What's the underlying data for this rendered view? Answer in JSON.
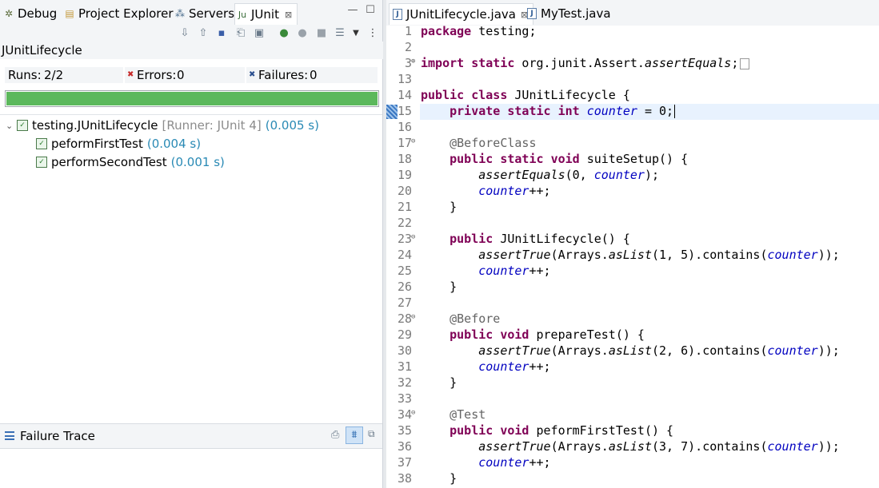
{
  "left_tabs": [
    {
      "label": "Debug",
      "icon": "bug-icon"
    },
    {
      "label": "Project Explorer",
      "icon": "folder-icon"
    },
    {
      "label": "Servers",
      "icon": "servers-icon"
    },
    {
      "label": "JUnit",
      "icon": "junit-icon"
    }
  ],
  "junit": {
    "title": "JUnitLifecycle",
    "runs_label": "Runs:",
    "runs_value": "2/2",
    "errors_label": "Errors:",
    "errors_value": "0",
    "failures_label": "Failures:",
    "failures_value": "0",
    "progress": 1.0,
    "progress_color": "#5cb85c",
    "tree": {
      "suite_label": "testing.JUnitLifecycle",
      "suite_runner": "[Runner: JUnit 4]",
      "suite_time": "(0.005 s)",
      "tests": [
        {
          "name": "peformFirstTest",
          "time": "(0.004 s)"
        },
        {
          "name": "performSecondTest",
          "time": "(0.001 s)"
        }
      ]
    },
    "failure_trace_label": "Failure Trace"
  },
  "editor": {
    "tabs": [
      {
        "label": "JUnitLifecycle.java",
        "active": true
      },
      {
        "label": "MyTest.java",
        "active": false
      }
    ],
    "lines": [
      {
        "n": "1",
        "t": "package testing;"
      },
      {
        "n": "2",
        "t": ""
      },
      {
        "n": "3",
        "t": "import static org.junit.Assert.assertEquals;"
      },
      {
        "n": "13",
        "t": ""
      },
      {
        "n": "14",
        "t": "public class JUnitLifecycle {"
      },
      {
        "n": "15",
        "t": "    private static int counter = 0;"
      },
      {
        "n": "16",
        "t": ""
      },
      {
        "n": "17",
        "t": "    @BeforeClass"
      },
      {
        "n": "18",
        "t": "    public static void suiteSetup() {"
      },
      {
        "n": "19",
        "t": "        assertEquals(0, counter);"
      },
      {
        "n": "20",
        "t": "        counter++;"
      },
      {
        "n": "21",
        "t": "    }"
      },
      {
        "n": "22",
        "t": ""
      },
      {
        "n": "23",
        "t": "    public JUnitLifecycle() {"
      },
      {
        "n": "24",
        "t": "        assertTrue(Arrays.asList(1, 5).contains(counter));"
      },
      {
        "n": "25",
        "t": "        counter++;"
      },
      {
        "n": "26",
        "t": "    }"
      },
      {
        "n": "27",
        "t": ""
      },
      {
        "n": "28",
        "t": "    @Before"
      },
      {
        "n": "29",
        "t": "    public void prepareTest() {"
      },
      {
        "n": "30",
        "t": "        assertTrue(Arrays.asList(2, 6).contains(counter));"
      },
      {
        "n": "31",
        "t": "        counter++;"
      },
      {
        "n": "32",
        "t": "    }"
      },
      {
        "n": "33",
        "t": ""
      },
      {
        "n": "34",
        "t": "    @Test"
      },
      {
        "n": "35",
        "t": "    public void peformFirstTest() {"
      },
      {
        "n": "36",
        "t": "        assertTrue(Arrays.asList(3, 7).contains(counter));"
      },
      {
        "n": "37",
        "t": "        counter++;"
      },
      {
        "n": "38",
        "t": "    }"
      }
    ],
    "active_line": "15"
  }
}
